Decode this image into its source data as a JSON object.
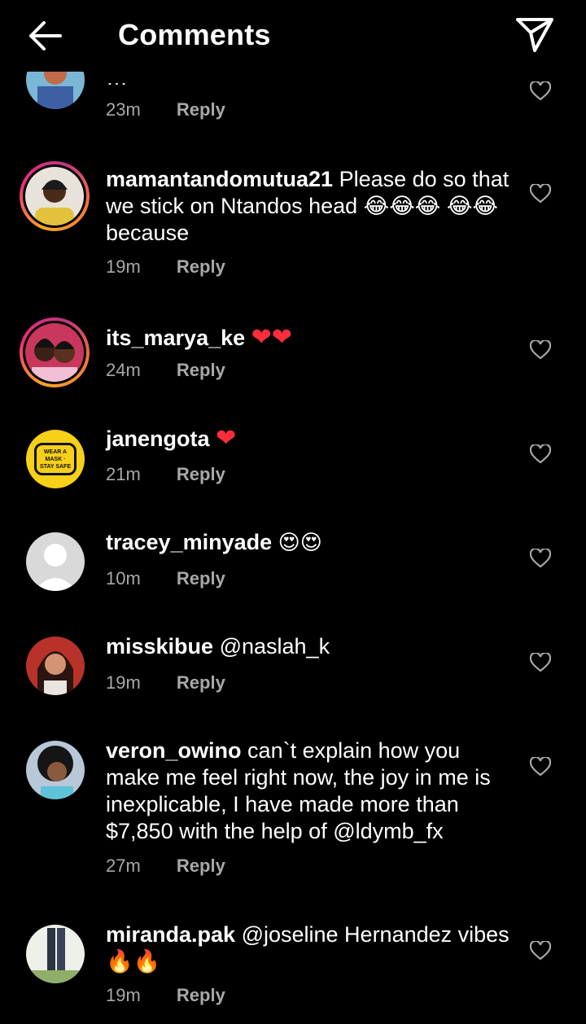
{
  "header": {
    "title": "Comments"
  },
  "comments": [
    {
      "partial_text": "…",
      "time": "23m",
      "reply": "Reply"
    },
    {
      "username": "mamantandomutua21",
      "text": "Please do so that we stick on Ntandos head 😂😂😂 😂😂 because",
      "time": "19m",
      "reply": "Reply"
    },
    {
      "username": "its_marya_ke",
      "text": "❤❤",
      "time": "24m",
      "reply": "Reply"
    },
    {
      "username": "janengota",
      "text": "❤",
      "time": "21m",
      "reply": "Reply",
      "avatar_text": "WEAR A MASK · STAY SAFE"
    },
    {
      "username": "tracey_minyade",
      "text": "😍😍",
      "time": "10m",
      "reply": "Reply"
    },
    {
      "username": "misskibue",
      "text": "@naslah_k",
      "time": "19m",
      "reply": "Reply"
    },
    {
      "username": "veron_owino",
      "text": "can`t explain how you make me feel right now, the joy in me is inexplicable, I have made more than $7,850 with the help of @ldymb_fx",
      "time": "27m",
      "reply": "Reply"
    },
    {
      "username": "miranda.pak",
      "text": "@joseline Hernandez vibes🔥🔥",
      "time": "19m",
      "reply": "Reply"
    }
  ],
  "icons": {
    "back": "arrow-left-icon",
    "send": "paper-plane-icon",
    "like": "heart-outline-icon",
    "heart_color": "#ff2d3a",
    "secondary_text_color": "#a8a8a8"
  }
}
